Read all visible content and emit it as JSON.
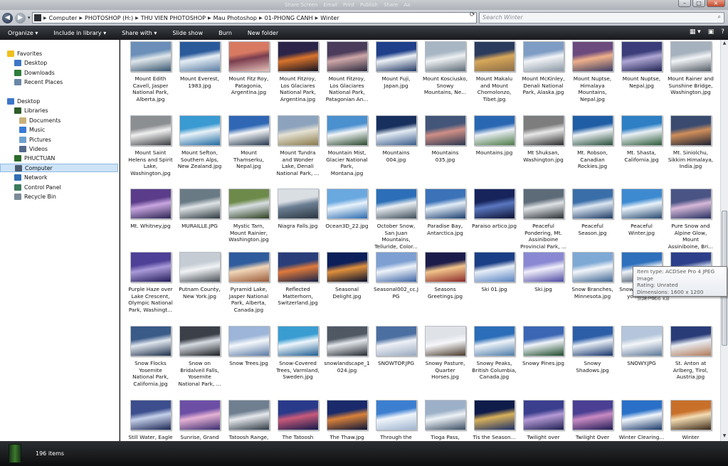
{
  "titlebar": {
    "items": [
      "Share Screen",
      "Email",
      "Print",
      "Publish",
      "Share",
      "Aa"
    ]
  },
  "window_controls": {
    "minimize": "–",
    "maximize": "□",
    "close": "×"
  },
  "address": {
    "crumbs": [
      "Computer",
      "PHOTOSHOP (H:)",
      "THU VIEN PHOTOSHOP",
      "Mau Photoshop",
      "01-PHONG CANH",
      "Winter"
    ],
    "search_placeholder": "Search Winter"
  },
  "toolbar": {
    "organize": "Organize ▾",
    "include": "Include in library ▾",
    "share": "Share with ▾",
    "slideshow": "Slide show",
    "burn": "Burn",
    "newfolder": "New folder"
  },
  "nav": {
    "items": [
      {
        "label": "Favorites",
        "icon": "star-icon",
        "color": "#f0c020"
      },
      {
        "label": "Desktop",
        "icon": "desktop-icon",
        "color": "#3d76c8"
      },
      {
        "label": "Downloads",
        "icon": "downloads-icon",
        "color": "#2e7d3c"
      },
      {
        "label": "Recent Places",
        "icon": "recent-places-icon",
        "color": "#6b87a8"
      },
      {
        "label": "Desktop",
        "icon": "desktop-icon",
        "color": "#3d76c8"
      },
      {
        "label": "Libraries",
        "icon": "libraries-icon",
        "color": "#2e5c2a"
      },
      {
        "label": "Documents",
        "icon": "documents-icon",
        "color": "#c9b27a"
      },
      {
        "label": "Music",
        "icon": "music-icon",
        "color": "#3a7bd5"
      },
      {
        "label": "Pictures",
        "icon": "pictures-icon",
        "color": "#6fa1cf"
      },
      {
        "label": "Videos",
        "icon": "videos-icon",
        "color": "#54698a"
      },
      {
        "label": "PHUCTUAN",
        "icon": "user-folder-icon",
        "color": "#2a6b2a"
      },
      {
        "label": "Computer",
        "icon": "computer-icon",
        "color": "#4a5b70"
      },
      {
        "label": "Network",
        "icon": "network-icon",
        "color": "#2f6fb5"
      },
      {
        "label": "Control Panel",
        "icon": "control-panel-icon",
        "color": "#3b7b5a"
      },
      {
        "label": "Recycle Bin",
        "icon": "recycle-bin-icon",
        "color": "#7a8b99"
      }
    ]
  },
  "files": [
    {
      "name": "Mount Edith Cavell, Jasper National Park, Alberta.jpg",
      "colors": [
        "#6b8fb8",
        "#dfe6ea",
        "#37546e"
      ]
    },
    {
      "name": "Mount Everest, 1983.jpg",
      "colors": [
        "#2a5a9a",
        "#e6eef5",
        "#5b7da3"
      ]
    },
    {
      "name": "Mount Fitz Roy, Patagonia, Argentina.jpg",
      "colors": [
        "#d87a62",
        "#7a3d4e",
        "#e5c0b8"
      ]
    },
    {
      "name": "Mount Fitzroy, Los Glaciares National Park, Argentina.jpg",
      "colors": [
        "#2b2448",
        "#d9742c",
        "#141322"
      ]
    },
    {
      "name": "Mount Fitzroy, Los Glaciares National Park, Patagonian An...",
      "colors": [
        "#4a3c5a",
        "#cfa7a8",
        "#2d2b3e"
      ]
    },
    {
      "name": "Mount Fuji, Japan.jpg",
      "colors": [
        "#1f3f8a",
        "#eef2f6",
        "#243a66"
      ]
    },
    {
      "name": "Mount Kosciusko, Snowy Mountains, Ne...",
      "colors": [
        "#a8b6c4",
        "#eef0f2",
        "#5c6b75"
      ]
    },
    {
      "name": "Mount Makalu and Mount Chomolonzo, Tibet.jpg",
      "colors": [
        "#2b3b5e",
        "#d8a85a",
        "#8c6d46"
      ]
    },
    {
      "name": "Mount McKinley, Denali National Park, Alaska.jpg",
      "colors": [
        "#7f9cc4",
        "#f2f4f7",
        "#8a98a5"
      ]
    },
    {
      "name": "Mount Nuptse, Himalaya Mountains, Nepal.jpg",
      "colors": [
        "#6d4a7e",
        "#f0b18a",
        "#3a3b63"
      ]
    },
    {
      "name": "Mount Nuptse, Nepal.jpg",
      "colors": [
        "#3a3d7a",
        "#b0a7d5",
        "#202453"
      ]
    },
    {
      "name": "Mount Rainer and Sunshine Bridge, Washington.jpg",
      "colors": [
        "#a5b1bd",
        "#f1f3f5",
        "#545e66"
      ]
    },
    {
      "name": "Mount Saint Helens and Spirit Lake, Washington.jpg",
      "colors": [
        "#8c8f92",
        "#f0f0f0",
        "#3b3e42"
      ]
    },
    {
      "name": "Mount Sefton, Southern Alps, New Zealand.jpg",
      "colors": [
        "#3a9ad2",
        "#e9f2f7",
        "#1e6aa2"
      ]
    },
    {
      "name": "Mount Thamserku, Nepal.jpg",
      "colors": [
        "#2f67b4",
        "#f3f5f7",
        "#26384f"
      ]
    },
    {
      "name": "Mount Tundra and Wonder Lake, Denali National Park, ...",
      "colors": [
        "#8da3bd",
        "#e4e1d3",
        "#8a7a4a"
      ]
    },
    {
      "name": "Mountain Mist, Glacier National Park, Montana.jpg",
      "colors": [
        "#4b90cf",
        "#f2f5f7",
        "#2b4b2e"
      ]
    },
    {
      "name": "Mountains 004.jpg",
      "colors": [
        "#17305e",
        "#e4ecf4",
        "#3b5c8a"
      ]
    },
    {
      "name": "Mountains 035.jpg",
      "colors": [
        "#435679",
        "#cf8f86",
        "#2a3650"
      ]
    },
    {
      "name": "Mountains.jpg",
      "colors": [
        "#2a67b3",
        "#e8eef4",
        "#4e7a46"
      ]
    },
    {
      "name": "Mt Shuksan, Washington.jpg",
      "colors": [
        "#7d7d7d",
        "#e8e8e8",
        "#2b2b2b"
      ]
    },
    {
      "name": "Mt. Robson, Canadian Rockies.jpg",
      "colors": [
        "#1f5ea5",
        "#eef2f6",
        "#28503a"
      ]
    },
    {
      "name": "Mt. Shasta, California.jpg",
      "colors": [
        "#2e7fc4",
        "#eaf0f5",
        "#2c5b38"
      ]
    },
    {
      "name": "Mt. Siniolchu, Sikkim Himalaya, India.jpg",
      "colors": [
        "#3b4b70",
        "#d08f5a",
        "#1d2133"
      ]
    },
    {
      "name": "Mt. Whitney.jpg",
      "colors": [
        "#5a3c8a",
        "#c8a6df",
        "#2d2453"
      ]
    },
    {
      "name": "MURAILLE.JPG",
      "colors": [
        "#6a7a85",
        "#dfe4e6",
        "#2e3a40"
      ]
    },
    {
      "name": "Mystic Tarn, Mount Rainier, Washington.jpg",
      "colors": [
        "#6e8a4a",
        "#d8dfe2",
        "#2d4020"
      ]
    },
    {
      "name": "Niagra Falls.jpg",
      "colors": [
        "#d9dee3",
        "#6b7f93",
        "#2b3540"
      ]
    },
    {
      "name": "Ocean3D_22.jpg",
      "colors": [
        "#6aa8e0",
        "#e9f3fb",
        "#2a6bb0"
      ]
    },
    {
      "name": "October Snow, San Juan Mountains, Telluride, Color...",
      "colors": [
        "#2c6fb8",
        "#e9eef2",
        "#3e4e5a"
      ]
    },
    {
      "name": "Paradise Bay, Antarctica.jpg",
      "colors": [
        "#3b72b8",
        "#e3edf6",
        "#1b3f70"
      ]
    },
    {
      "name": "Paraiso artico.jpg",
      "colors": [
        "#17245c",
        "#5a77c0",
        "#0c1233"
      ]
    },
    {
      "name": "Peaceful Pondering, Mt. Assiniboine Provincial Park, ...",
      "colors": [
        "#5d6b79",
        "#dfe3e6",
        "#2a2f35"
      ]
    },
    {
      "name": "Peaceful Season.jpg",
      "colors": [
        "#3a6ea8",
        "#dce7f2",
        "#1d3b66"
      ]
    },
    {
      "name": "Peaceful Winter.jpg",
      "colors": [
        "#3d8ad0",
        "#eaf3fa",
        "#274a70"
      ]
    },
    {
      "name": "Pure Snow and Alpine Glow, Mount Assiniboine, Bri...",
      "colors": [
        "#4a5485",
        "#d7b8d8",
        "#263061"
      ]
    },
    {
      "name": "Purple Haze over Lake Crescent, Olympic National Park, Washingt...",
      "colors": [
        "#4e3f97",
        "#a99ad9",
        "#241c5a"
      ]
    },
    {
      "name": "Putnam County, New York.jpg",
      "colors": [
        "#c5ccd3",
        "#f1f3f5",
        "#4a5058"
      ]
    },
    {
      "name": "Pyramid Lake, Jasper National Park, Alberta, Canada.jpg",
      "colors": [
        "#2f5c9c",
        "#f1d6b8",
        "#9a5b3a"
      ]
    },
    {
      "name": "Reflected Matterhorn, Switzerland.jpg",
      "colors": [
        "#2a3f7a",
        "#e07a3b",
        "#162247"
      ]
    },
    {
      "name": "Seasonal Delight.jpg",
      "colors": [
        "#0d1f5a",
        "#e0903c",
        "#070f2d"
      ]
    },
    {
      "name": "Seasonal002_cc.JPG",
      "colors": [
        "#7d9fd2",
        "#eef3fa",
        "#3f66a5"
      ]
    },
    {
      "name": "Seasons Greetings.jpg",
      "colors": [
        "#1c1c4a",
        "#f1c48a",
        "#8b2a2a"
      ]
    },
    {
      "name": "Ski 01.jpg",
      "colors": [
        "#1b3f87",
        "#e7eef7",
        "#5a83c2"
      ]
    },
    {
      "name": "Ski.jpg",
      "colors": [
        "#8a88d2",
        "#f0eefa",
        "#4e4aa3"
      ]
    },
    {
      "name": "Snow Branches, Minnesota.jpg",
      "colors": [
        "#7fa9d5",
        "#f3f6fa",
        "#3f6693"
      ]
    },
    {
      "name": "Snow...Grand...Wyoming.jpg",
      "colors": [
        "#2f70bd",
        "#eef2f7",
        "#2b3f58"
      ]
    },
    {
      "name": "...Range.jpg",
      "colors": [
        "#2c3f8a",
        "#cfd9ef",
        "#161e4d"
      ]
    },
    {
      "name": "Snow Flocks Yosemite National Park, California.jpg",
      "colors": [
        "#3a5a87",
        "#dfe6ee",
        "#1e2f4a"
      ]
    },
    {
      "name": "Snow on Bridalveil Falls, Yosemite National Park, ...",
      "colors": [
        "#3a3f48",
        "#d6dbe1",
        "#1b1e23"
      ]
    },
    {
      "name": "Snow Trees.jpg",
      "colors": [
        "#9cb5d8",
        "#f4f7fb",
        "#5a7aa5"
      ]
    },
    {
      "name": "Snow-Covered Trees, Varmland, Sweden.jpg",
      "colors": [
        "#3a9dd2",
        "#eef6fb",
        "#1f5f93"
      ]
    },
    {
      "name": "snowlandscape_1024.jpg",
      "colors": [
        "#505864",
        "#e3e6ea",
        "#252a31"
      ]
    },
    {
      "name": "SNOWTOP.JPG",
      "colors": [
        "#4c6fa2",
        "#eef1f6",
        "#9aa9c0"
      ]
    },
    {
      "name": "Snowy Pasture, Quarter Horses.jpg",
      "colors": [
        "#dfe3e8",
        "#f6f7f9",
        "#4b3a2a"
      ]
    },
    {
      "name": "Snowy Peaks, British Columbia, Canada.jpg",
      "colors": [
        "#2b6db8",
        "#eef3f8",
        "#4c7ba8"
      ]
    },
    {
      "name": "Snowy Pines.jpg",
      "colors": [
        "#3a66b4",
        "#f0f4f9",
        "#1d4a2a"
      ]
    },
    {
      "name": "Snowy Shadows.jpg",
      "colors": [
        "#2c5ea8",
        "#e8eef6",
        "#15346a"
      ]
    },
    {
      "name": "SNOWY.JPG",
      "colors": [
        "#b5c6dc",
        "#f4f6f9",
        "#5b7698"
      ]
    },
    {
      "name": "St. Anton at Arlberg, Tirol, Austria.jpg",
      "colors": [
        "#2a3c78",
        "#e9edf4",
        "#b27b5a"
      ]
    },
    {
      "name": "Still Water, Eagle River, Alaska.jpg",
      "colors": [
        "#3c4e8e",
        "#c5d0ea",
        "#1c2753"
      ]
    },
    {
      "name": "Sunrise, Grand Teton National...",
      "colors": [
        "#6c4ea5",
        "#e6b2d5",
        "#3a2b6d"
      ]
    },
    {
      "name": "Tatoosh Range, Mount Rainier...",
      "colors": [
        "#6f7f90",
        "#e6e9ec",
        "#2f3a45"
      ]
    },
    {
      "name": "The Tatoosh Range in Winter...",
      "colors": [
        "#2a3a8a",
        "#c85a7a",
        "#13194a"
      ]
    },
    {
      "name": "The Thaw.jpg",
      "colors": [
        "#1a2a6a",
        "#d8823a",
        "#0d1538"
      ]
    },
    {
      "name": "Through the Iceberg...",
      "colors": [
        "#3c7fd0",
        "#f0f5fb",
        "#9fb4cf"
      ]
    },
    {
      "name": "Tioga Pass, Yosemite...",
      "colors": [
        "#9cb0c8",
        "#eef2f6",
        "#3b4e64"
      ]
    },
    {
      "name": "Tis the Season...",
      "colors": [
        "#0f1c4a",
        "#d8b15a",
        "#1c2f66"
      ]
    },
    {
      "name": "Twilight over Chilkat Range...",
      "colors": [
        "#3b3f8e",
        "#b59ad5",
        "#1d1f52"
      ]
    },
    {
      "name": "Twilight Over South Tufa...",
      "colors": [
        "#4a3f93",
        "#c98ac2",
        "#201b55"
      ]
    },
    {
      "name": "Winter Clearing...",
      "colors": [
        "#2a70c8",
        "#f0f5fb",
        "#1a3a6a"
      ]
    },
    {
      "name": "Winter Embraced, Shilsh...",
      "colors": [
        "#c8702a",
        "#f3dcb3",
        "#3b2a1a"
      ]
    }
  ],
  "tooltip": {
    "type": "Item type: ACDSee Pro 4 JPEG Image",
    "rating": "Rating: Unrated",
    "dimensions": "Dimensions: 1600 x 1200",
    "size": "Size: 406 KB"
  },
  "status": {
    "count": "196 items"
  }
}
